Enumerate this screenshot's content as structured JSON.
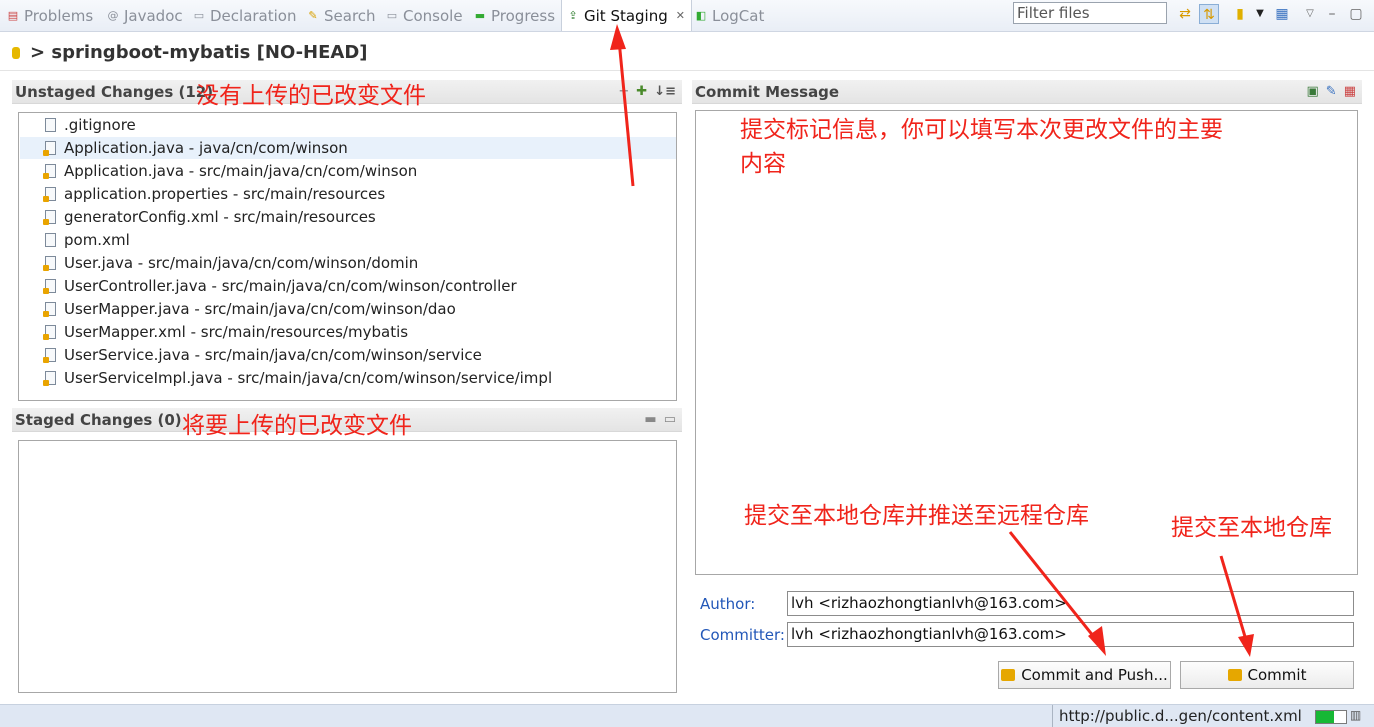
{
  "tabs": [
    {
      "label": "Problems",
      "icon": "problems-icon",
      "active": false
    },
    {
      "label": "Javadoc",
      "icon": "javadoc-icon",
      "active": false
    },
    {
      "label": "Declaration",
      "icon": "declaration-icon",
      "active": false
    },
    {
      "label": "Search",
      "icon": "search-icon",
      "active": false
    },
    {
      "label": "Console",
      "icon": "console-icon",
      "active": false
    },
    {
      "label": "Progress",
      "icon": "progress-icon",
      "active": false
    },
    {
      "label": "Git Staging",
      "icon": "git-staging-icon",
      "active": true
    },
    {
      "label": "LogCat",
      "icon": "logcat-icon",
      "active": false
    }
  ],
  "filter": {
    "placeholder": "Filter files"
  },
  "repository": {
    "title": "> springboot-mybatis [NO-HEAD]"
  },
  "unstaged": {
    "header": "Unstaged Changes (12)",
    "files": [
      ".gitignore",
      "Application.java - java/cn/com/winson",
      "Application.java - src/main/java/cn/com/winson",
      "application.properties - src/main/resources",
      "generatorConfig.xml - src/main/resources",
      "pom.xml",
      "User.java - src/main/java/cn/com/winson/domin",
      "UserController.java - src/main/java/cn/com/winson/controller",
      "UserMapper.java - src/main/java/cn/com/winson/dao",
      "UserMapper.xml - src/main/resources/mybatis",
      "UserService.java - src/main/java/cn/com/winson/service",
      "UserServiceImpl.java - src/main/java/cn/com/winson/service/impl"
    ],
    "selected_index": 1
  },
  "staged": {
    "header": "Staged Changes (0)"
  },
  "commit": {
    "header": "Commit Message",
    "author_label": "Author:",
    "author": "lvh <rizhaozhongtianlvh@163.com>",
    "committer_label": "Committer:",
    "committer": "lvh <rizhaozhongtianlvh@163.com>",
    "commit_push_label": "Commit and Push...",
    "commit_label": "Commit"
  },
  "annotations": {
    "unstaged": "没有上传的已改变文件",
    "staged": "将要上传的已改变文件",
    "message_line1": "提交标记信息，你可以填写本次更改文件的主要",
    "message_line2": "内容",
    "commit_push": "提交至本地仓库并推送至远程仓库",
    "commit": "提交至本地仓库"
  },
  "status": {
    "url": "http://public.d...gen/content.xml",
    "progress": 0.6
  },
  "colors": {
    "annotation": "#f0241b",
    "label_blue": "#2257b8",
    "selection": "#e8f1fb"
  }
}
